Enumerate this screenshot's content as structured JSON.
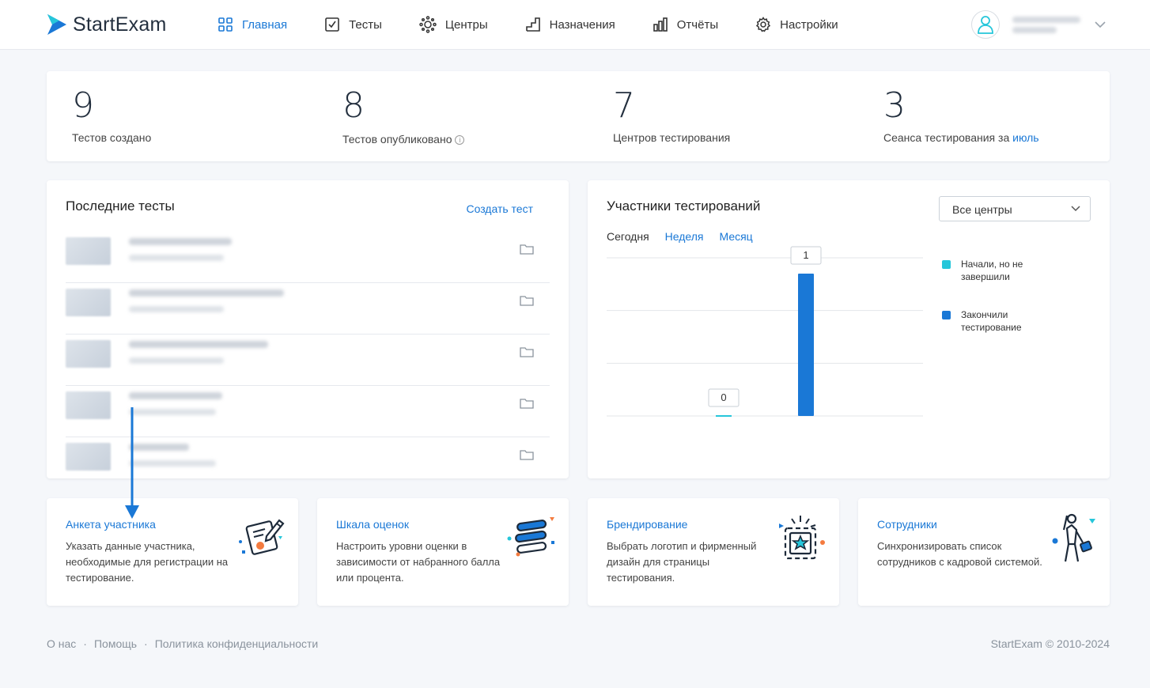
{
  "brand": {
    "name": "StartExam",
    "accent": "#1a78d6"
  },
  "nav": [
    {
      "label": "Главная",
      "icon": "grid-icon",
      "active": true
    },
    {
      "label": "Тесты",
      "icon": "checkbox-icon",
      "active": false
    },
    {
      "label": "Центры",
      "icon": "centers-icon",
      "active": false
    },
    {
      "label": "Назначения",
      "icon": "steps-icon",
      "active": false
    },
    {
      "label": "Отчёты",
      "icon": "bars-icon",
      "active": false
    },
    {
      "label": "Настройки",
      "icon": "gear-icon",
      "active": false
    }
  ],
  "stats": [
    {
      "value": "9",
      "label": "Тестов создано"
    },
    {
      "value": "8",
      "label": "Тестов опубликовано",
      "info": "i"
    },
    {
      "value": "7",
      "label": "Центров тестирования"
    },
    {
      "value": "3",
      "label": "Сеанса тестирования за ",
      "link": "июль"
    }
  ],
  "recent": {
    "title": "Последние тесты",
    "create_label": "Создать тест"
  },
  "participants": {
    "title": "Участники тестирований",
    "select_value": "Все центры",
    "periods": [
      "Сегодня",
      "Неделя",
      "Месяц"
    ],
    "active_period": "Сегодня"
  },
  "chart_data": {
    "type": "bar",
    "categories": [
      "",
      ""
    ],
    "series": [
      {
        "name": "Начали, но не завершили",
        "color": "#26c6da",
        "values": [
          0,
          null
        ]
      },
      {
        "name": "Закончили тестирование",
        "color": "#1a78d6",
        "values": [
          null,
          1
        ]
      }
    ],
    "data_labels": [
      "0",
      "1"
    ],
    "grid": true,
    "legend": "right"
  },
  "features": [
    {
      "title": "Анкета участника",
      "desc": "Указать данные участника, необходимые для регистрации на тестирование.",
      "icon": "form-pencil-icon"
    },
    {
      "title": "Шкала оценок",
      "desc": "Настроить уровни оценки в зависимости от набранного балла или процента.",
      "icon": "scale-bars-icon"
    },
    {
      "title": "Брендирование",
      "desc": "Выбрать логотип и фирменный дизайн для страницы тестирования.",
      "icon": "star-frame-icon"
    },
    {
      "title": "Сотрудники",
      "desc": "Синхронизировать список сотрудников с кадровой системой.",
      "icon": "person-briefcase-icon"
    }
  ],
  "footer": {
    "links": [
      "О нас",
      "Помощь",
      "Политика конфиденциальности"
    ],
    "copyright": "StartExam © 2010-2024"
  }
}
